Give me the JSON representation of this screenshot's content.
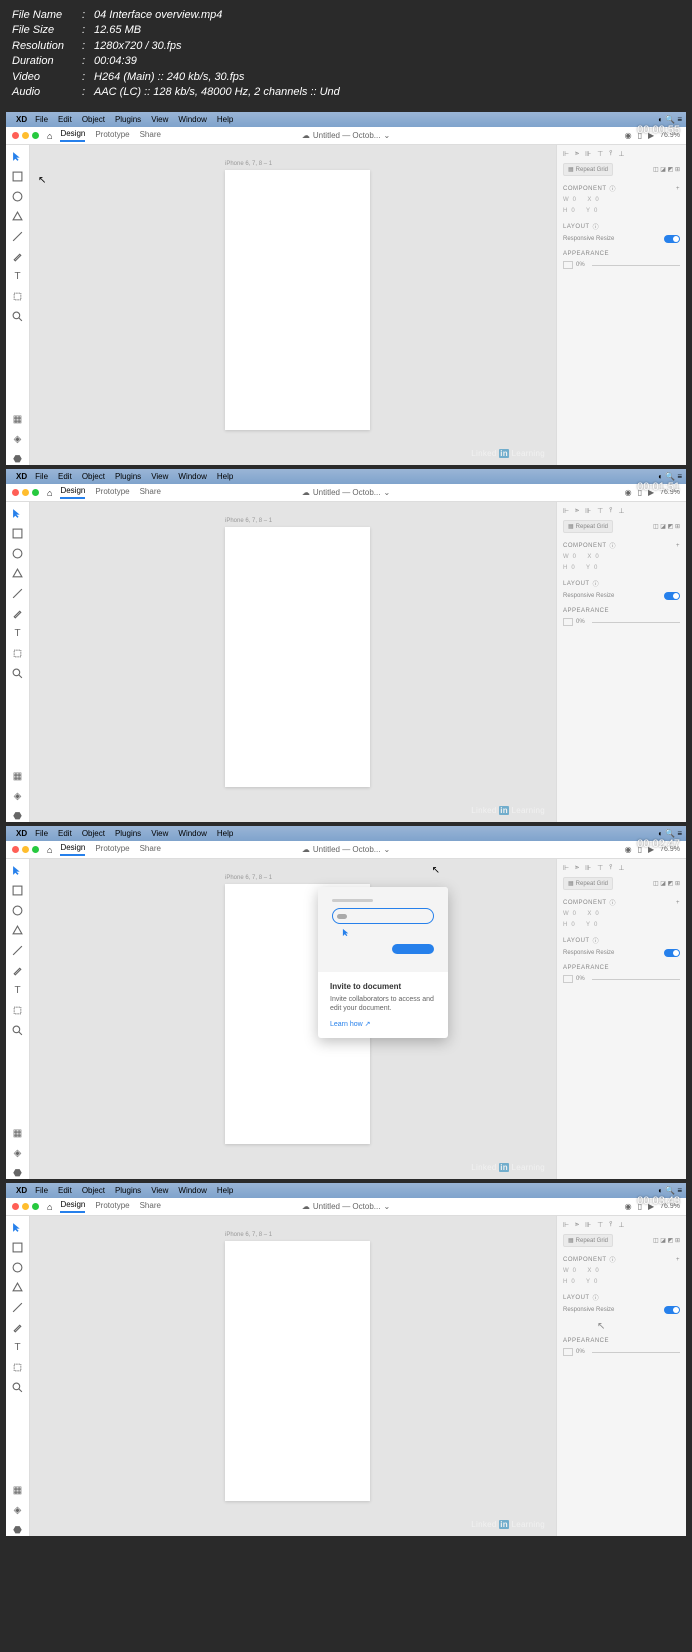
{
  "meta": {
    "fileName": {
      "label": "File Name",
      "value": "04 Interface overview.mp4"
    },
    "fileSize": {
      "label": "File Size",
      "value": "12.65 MB"
    },
    "resolution": {
      "label": "Resolution",
      "value": "1280x720 / 30.fps"
    },
    "duration": {
      "label": "Duration",
      "value": "00:04:39"
    },
    "video": {
      "label": "Video",
      "value": "H264 (Main) :: 240 kb/s, 30.fps"
    },
    "audio": {
      "label": "Audio",
      "value": "AAC (LC) :: 128 kb/s, 48000 Hz, 2 channels :: Und"
    }
  },
  "menubar": {
    "app": "XD",
    "items": [
      "File",
      "Edit",
      "Object",
      "Plugins",
      "View",
      "Window",
      "Help"
    ]
  },
  "tabs": {
    "home": "⌂",
    "items": [
      "Design",
      "Prototype",
      "Share"
    ],
    "title": "Untitled — Octob...",
    "zoom": "76.9%"
  },
  "artboardLabel": "iPhone 6, 7, 8 – 1",
  "inspector": {
    "repeatGrid": "Repeat Grid",
    "component": "COMPONENT",
    "w": "W",
    "x": "X",
    "h": "H",
    "y": "Y",
    "zero": "0",
    "layout": "LAYOUT",
    "responsive": "Responsive Resize",
    "appearance": "APPEARANCE",
    "opacity": "0%"
  },
  "popover": {
    "title": "Invite to document",
    "desc": "Invite collaborators to access and edit your document.",
    "link": "Learn how"
  },
  "timestamps": [
    "00:00:55",
    "00:01:51",
    "00:02:47",
    "00:03:43"
  ],
  "watermark": {
    "linked": "Linked",
    "in": "in",
    "learning": "Learning"
  }
}
